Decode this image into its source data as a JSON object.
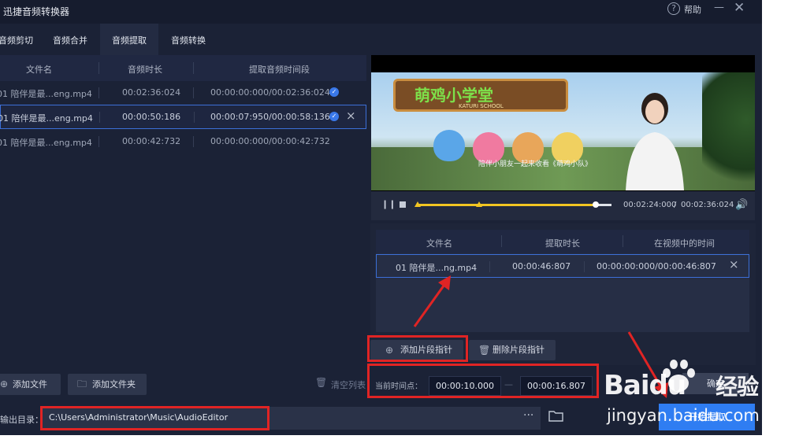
{
  "app": {
    "title": "迅捷音频转换器",
    "help_label": "帮助",
    "minimize_glyph": "—",
    "close_glyph": "✕"
  },
  "tabs": [
    {
      "label": "音频剪切",
      "active": false
    },
    {
      "label": "音频合并",
      "active": false
    },
    {
      "label": "音频提取",
      "active": true
    },
    {
      "label": "音频转换",
      "active": false
    }
  ],
  "file_table": {
    "headers": [
      "文件名",
      "音频时长",
      "提取音频时间段"
    ],
    "rows": [
      {
        "name": "01 陪伴是最...eng.mp4",
        "duration": "00:02:36:024",
        "range": "00:00:00:000/00:02:36:024",
        "checked": true,
        "selected": false
      },
      {
        "name": "01 陪伴是最...eng.mp4",
        "duration": "00:00:50:186",
        "range": "00:00:07:950/00:00:58:136",
        "checked": true,
        "selected": true
      },
      {
        "name": "01 陪伴是最...eng.mp4",
        "duration": "00:00:42:732",
        "range": "00:00:00:000/00:00:42:732",
        "checked": false,
        "selected": false
      }
    ]
  },
  "buttons": {
    "add_file": "添加文件",
    "add_folder": "添加文件夹",
    "clear_list": "清空列表",
    "add_segment": "添加片段指针",
    "delete_segment": "删除片段指针",
    "ok": "确定",
    "start": "开始提取"
  },
  "output": {
    "label": "输出目录：",
    "path": "C:\\Users\\Administrator\\Music\\AudioEditor",
    "more": "···"
  },
  "player": {
    "current_time": "00:02:24:000",
    "separator": "/",
    "total_time": "00:02:36:024",
    "progress": 0.92,
    "marker_positions": [
      0.0,
      0.3
    ],
    "video_logo": "萌鸡小学堂",
    "video_logo_sub": "KATURI SCHOOL",
    "video_caption": "陪伴小朋友一起来收看《萌鸡小队》"
  },
  "segment_table": {
    "headers": [
      "文件名",
      "提取时长",
      "在视频中的时间"
    ],
    "rows": [
      {
        "name": "01 陪伴是...ng.mp4",
        "duration": "00:00:46:807",
        "range": "00:00:00:000/00:00:46:807"
      }
    ]
  },
  "time_range": {
    "label": "当前时间点：",
    "start": "00:00:10.000",
    "end": "00:00:16.807",
    "dash": "—"
  },
  "watermark": {
    "brand": "Baidu",
    "brand_cn": "经验",
    "site": "jingyan.baidu.com"
  },
  "colors": {
    "accent": "#2f7df2",
    "highlight": "#e02424",
    "selection": "#3c6fd8",
    "marker": "#f2c522"
  },
  "icons": [
    "help-icon",
    "check-icon",
    "close-icon",
    "plus-circle-icon",
    "folder-icon",
    "trash-icon",
    "pause-icon",
    "stop-icon",
    "volume-icon",
    "more-icon",
    "folder-open-icon",
    "arrow-annotation"
  ]
}
